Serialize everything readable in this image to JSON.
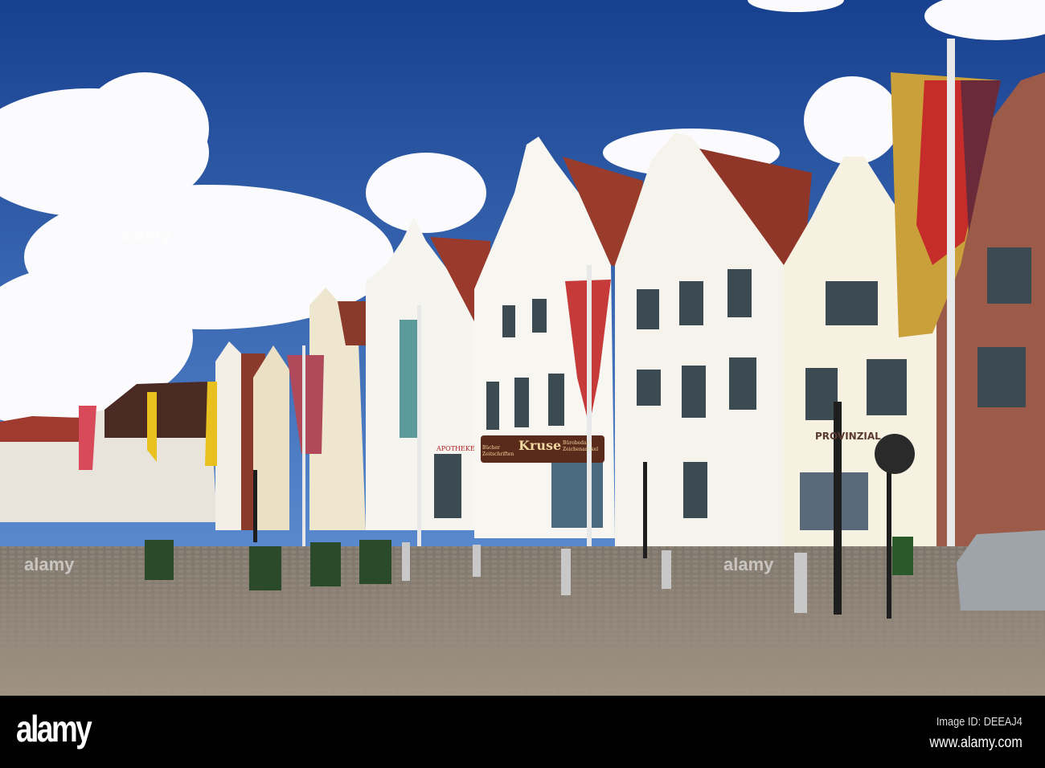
{
  "photo": {
    "signs": {
      "pharmacy": "APOTHEKE",
      "shop": "Kruse",
      "shop_left": "Bücher Zeitschriften",
      "shop_right": "Bürobedarf Zeichenartikel",
      "insurance": "PROVINZIAL"
    },
    "watermark": "alamy",
    "colors": {
      "sky": "#2a5aa8",
      "facade": "#f1ede2",
      "roof": "#8a3a2a",
      "brick": "#9a5a4a",
      "cobble": "#8c8376"
    }
  },
  "footer": {
    "logo": "alamy",
    "image_id": "Image ID: DEEAJ4",
    "url": "www.alamy.com"
  }
}
